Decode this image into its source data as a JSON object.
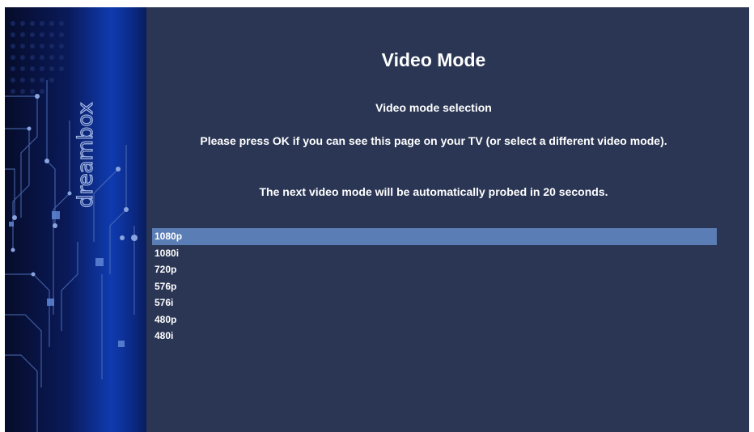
{
  "screen": {
    "title": "Video Mode",
    "subtitle": "Video mode selection",
    "message": "Please press OK if you can see this page on your TV (or select a different video mode).",
    "probe_text": "The next video mode will be automatically probed in 20 seconds."
  },
  "branding": {
    "logo_text": "dreambox"
  },
  "modes": {
    "items": [
      {
        "label": "1080p",
        "selected": true
      },
      {
        "label": "1080i",
        "selected": false
      },
      {
        "label": "720p",
        "selected": false
      },
      {
        "label": "576p",
        "selected": false
      },
      {
        "label": "576i",
        "selected": false
      },
      {
        "label": "480p",
        "selected": false
      },
      {
        "label": "480i",
        "selected": false
      }
    ]
  },
  "colors": {
    "background": "#2a3654",
    "selection": "#5b7db5",
    "text": "#ffffff",
    "sidebar_accent": "#0f3bb0"
  }
}
